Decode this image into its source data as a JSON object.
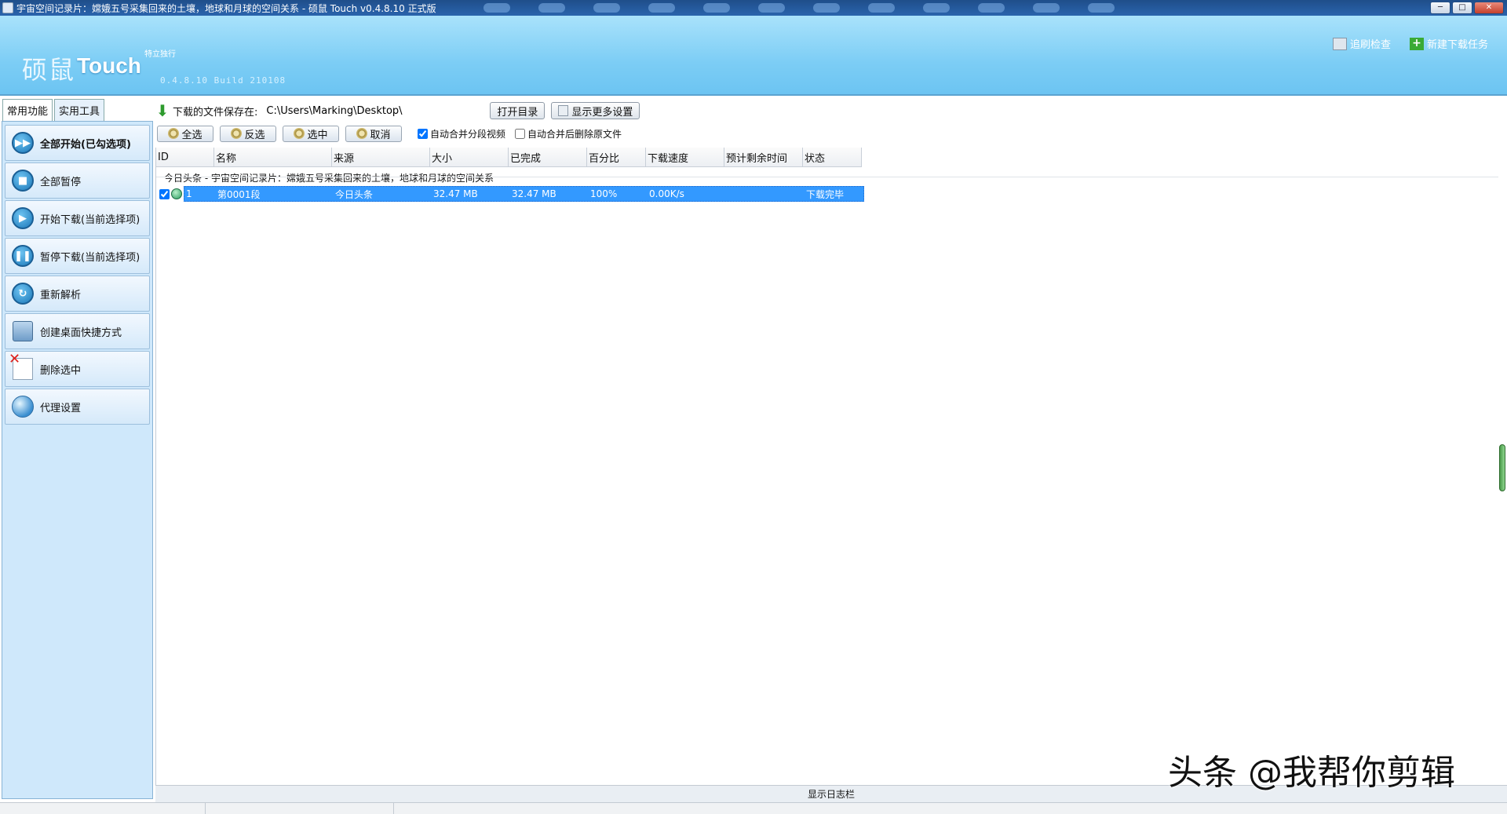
{
  "window": {
    "title": "宇宙空间记录片：嫦娥五号采集回来的土壤，地球和月球的空间关系 - 硕鼠 Touch v0.4.8.10 正式版",
    "buttons": {
      "minimize": "─",
      "maximize": "□",
      "close": "✕"
    }
  },
  "header": {
    "logo_cn": "硕鼠",
    "logo_en": "Touch",
    "tagline": "特立独行",
    "version": "0.4.8.10  Build 210108",
    "actions": {
      "check": "追刷检查",
      "new_task": "新建下载任务"
    }
  },
  "left_tabs": [
    "常用功能",
    "实用工具"
  ],
  "sidebar": {
    "items": [
      {
        "label": "全部开始(已勾选项)",
        "icon": "double-play-icon"
      },
      {
        "label": "全部暂停",
        "icon": "stop-icon"
      },
      {
        "label": "开始下载(当前选择项)",
        "icon": "play-icon"
      },
      {
        "label": "暂停下载(当前选择项)",
        "icon": "pause-icon"
      },
      {
        "label": "重新解析",
        "icon": "refresh-icon"
      },
      {
        "label": "创建桌面快捷方式",
        "icon": "monitor-icon"
      },
      {
        "label": "删除选中",
        "icon": "delete-icon"
      },
      {
        "label": "代理设置",
        "icon": "globe-icon"
      }
    ]
  },
  "path": {
    "label": "下载的文件保存在:",
    "value": "C:\\Users\\Marking\\Desktop\\",
    "open_dir": "打开目录",
    "more_settings": "显示更多设置"
  },
  "toolbar": {
    "select_all": "全选",
    "invert": "反选",
    "select": "选中",
    "cancel": "取消",
    "auto_merge": "自动合并分段视频",
    "auto_merge_checked": true,
    "auto_delete": "自动合并后删除原文件",
    "auto_delete_checked": false
  },
  "table": {
    "columns": [
      "ID",
      "名称",
      "来源",
      "大小",
      "已完成",
      "百分比",
      "下载速度",
      "预计剩余时间",
      "状态"
    ],
    "group_title": "今日头条 - 宇宙空间记录片：嫦娥五号采集回来的土壤，地球和月球的空间关系",
    "rows": [
      {
        "id": "1",
        "name": "第0001段",
        "source": "今日头条",
        "size": "32.47 MB",
        "done": "32.47 MB",
        "percent": "100%",
        "speed": "0.00K/s",
        "eta": "",
        "status": "下载完毕",
        "checked": true
      }
    ]
  },
  "log_toggle": "显示日志栏",
  "watermark": "头条 @我帮你剪辑"
}
